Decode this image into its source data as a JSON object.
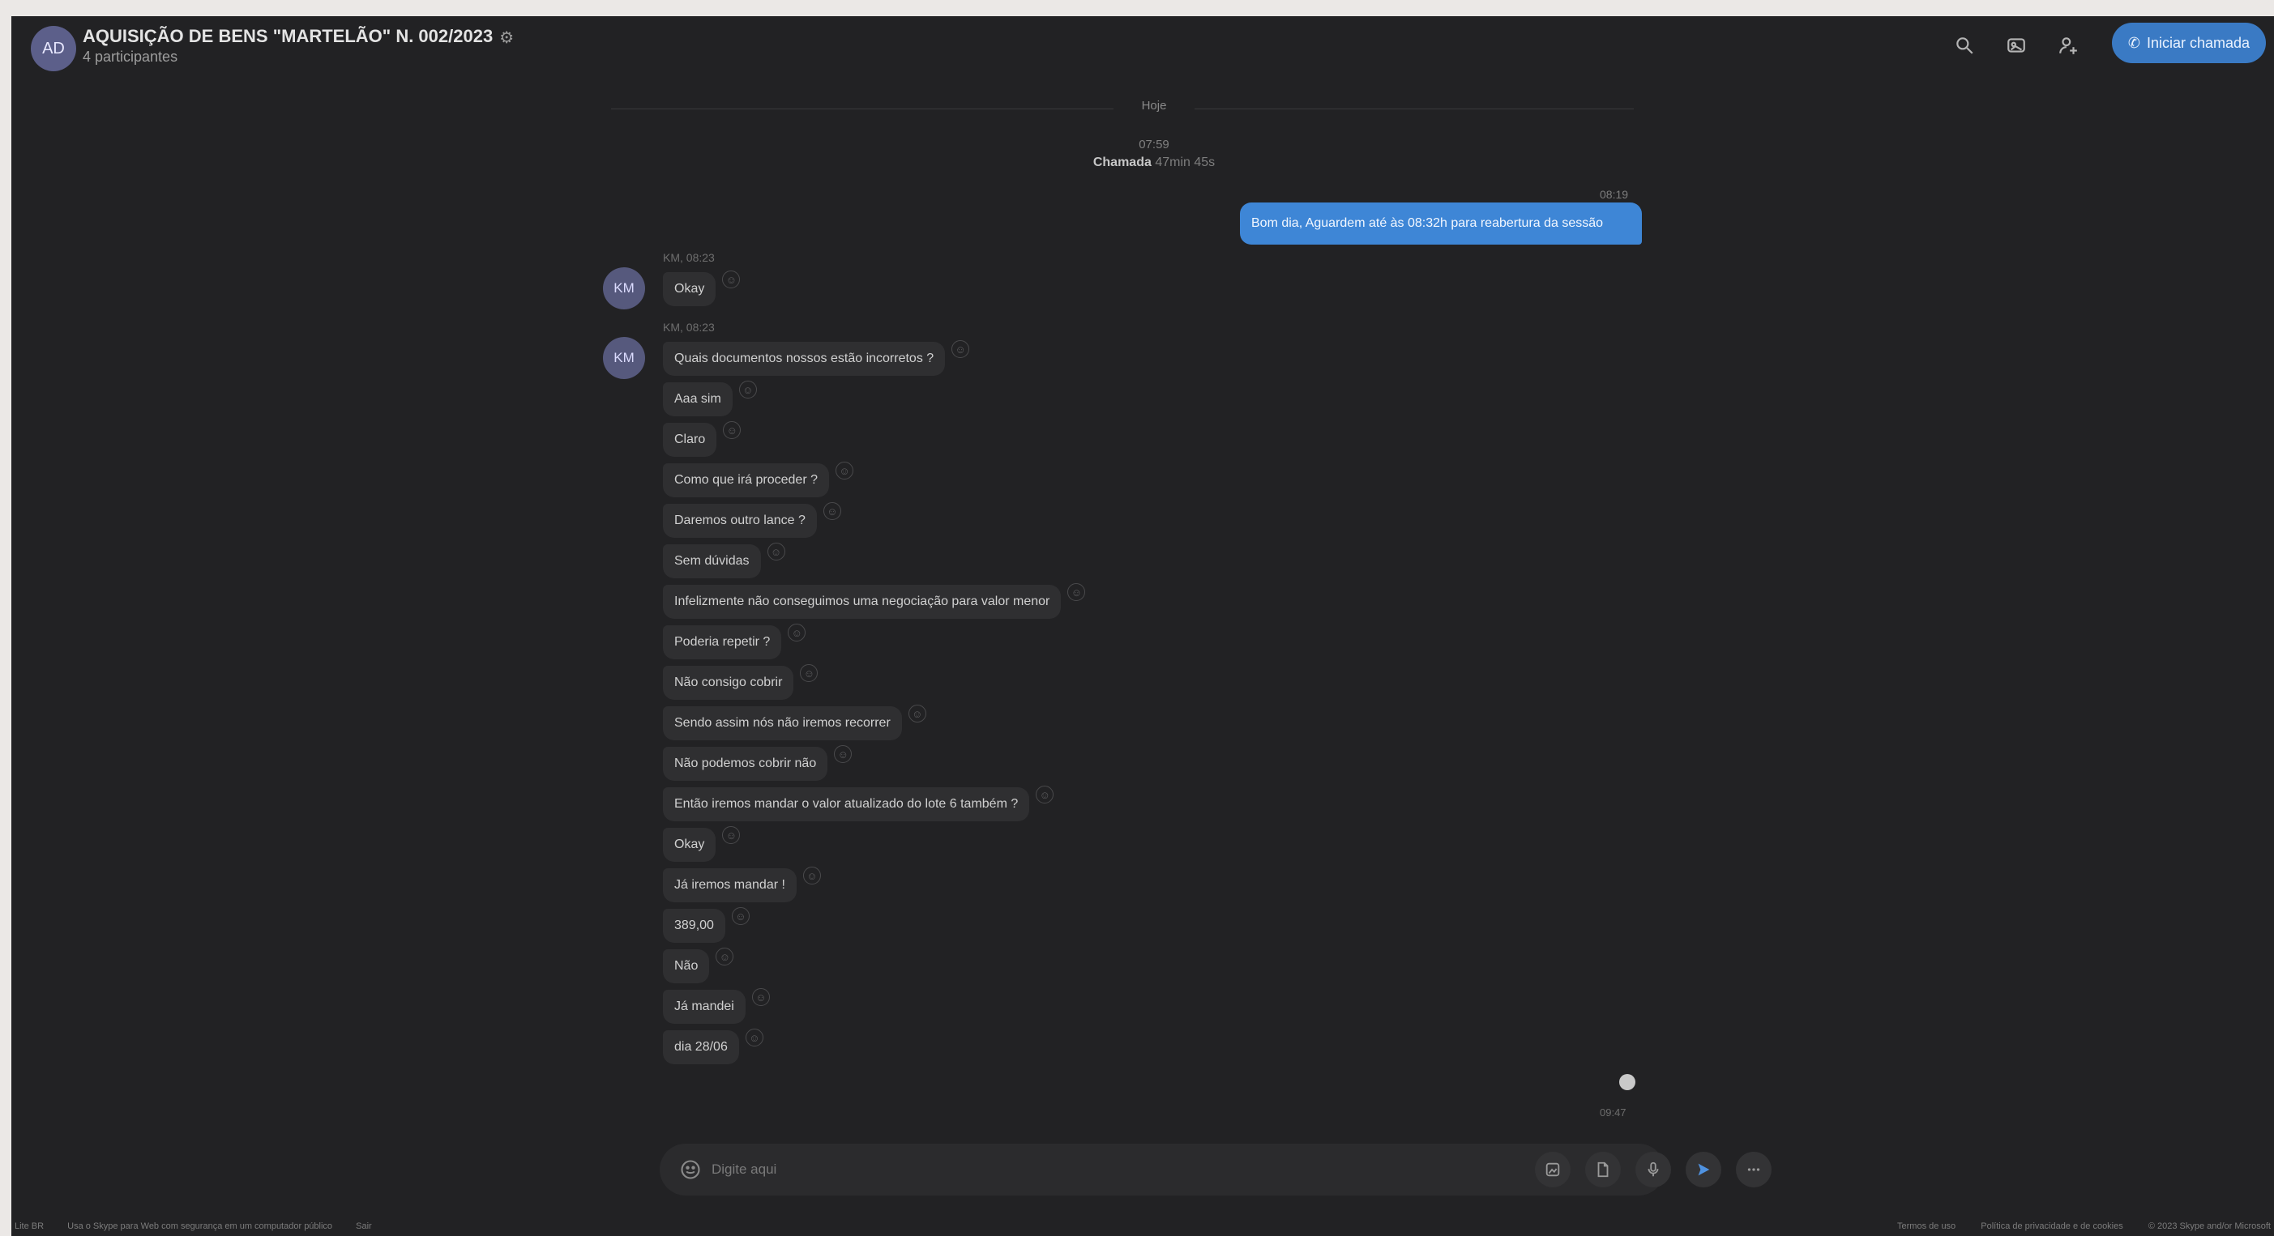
{
  "header": {
    "avatar": "AD",
    "title": "AQUISIÇÃO DE BENS \"MARTELÃO\" N. 002/2023",
    "subtitle": "4 participantes",
    "call_button": "Iniciar chamada",
    "icons": [
      "search-icon",
      "gallery-icon",
      "add-person-icon"
    ]
  },
  "timeline": {
    "day": "Hoje",
    "call_time": "07:59",
    "call_label": "Chamada",
    "call_duration": "47min 45s"
  },
  "outgoing": {
    "time": "08:19",
    "text": "Bom dia, Aguardem até às 08:32h para reabertura da sessão"
  },
  "groups": [
    {
      "avatar": "KM",
      "sender": "KM, 08:23",
      "messages": [
        "Okay"
      ]
    },
    {
      "avatar": "KM",
      "sender": "KM, 08:23",
      "messages": [
        "Quais documentos nossos estão incorretos ?",
        "Aaa sim",
        "Claro",
        "Como que irá proceder ?",
        "Daremos outro lance ?",
        "Sem dúvidas",
        "Infelizmente não conseguimos uma negociação para valor menor",
        "Poderia repetir ?",
        "Não consigo cobrir",
        "Sendo assim nós não iremos recorrer",
        "Não podemos cobrir não",
        "Então iremos mandar o valor atualizado do lote 6 também ?",
        "Okay",
        "Já iremos mandar !",
        "389,00",
        "Não",
        "Já mandei",
        "dia 28/06"
      ]
    }
  ],
  "seen_time": "09:47",
  "composer": {
    "placeholder": "Digite aqui"
  },
  "footer": {
    "left": [
      "Lite BR",
      "Usa o Skype para Web com segurança em um computador público",
      "Sair"
    ],
    "right": [
      "Termos de uso",
      "Política de privacidade e de cookies",
      "© 2023 Skype and/or Microsoft"
    ]
  }
}
